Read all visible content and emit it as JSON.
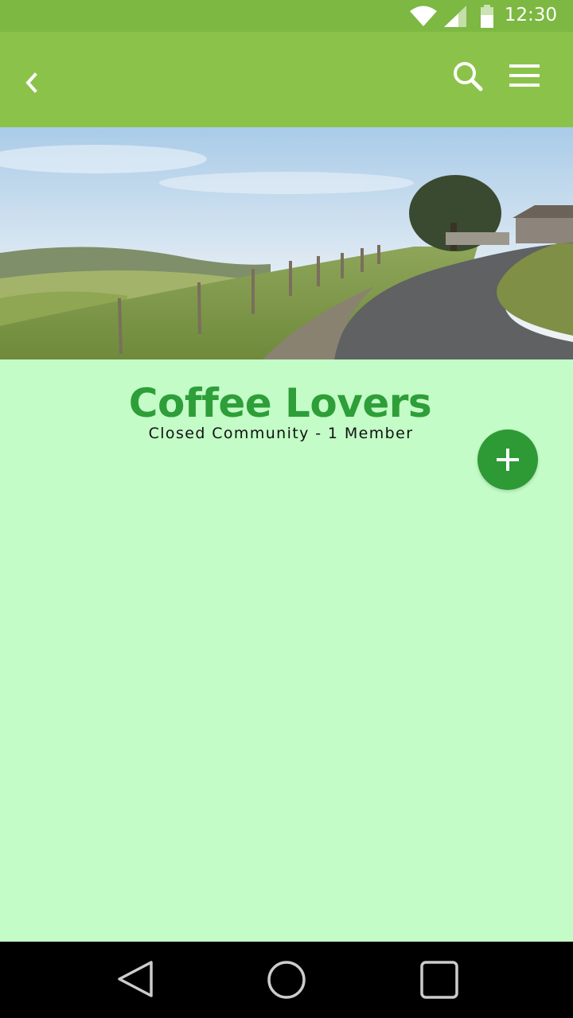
{
  "status_bar": {
    "time": "12:30",
    "icons": [
      "wifi-icon",
      "cellular-signal-icon",
      "battery-icon"
    ]
  },
  "app_bar": {
    "back_icon": "chevron-left-icon",
    "search_icon": "search-icon",
    "menu_icon": "hamburger-menu-icon",
    "color": "#8bc34a"
  },
  "hero": {
    "image": "landscape-road-photo"
  },
  "community": {
    "name": "Coffee Lovers",
    "meta": "Closed Community - 1 Member"
  },
  "fab": {
    "icon": "plus-icon",
    "color": "#2e9a35"
  },
  "nav_bar": {
    "icons": [
      "back-triangle-icon",
      "home-circle-icon",
      "recents-square-icon"
    ]
  },
  "colors": {
    "status_bar": "#7cb842",
    "background": "#c3fcc7",
    "title": "#2e9e38"
  }
}
